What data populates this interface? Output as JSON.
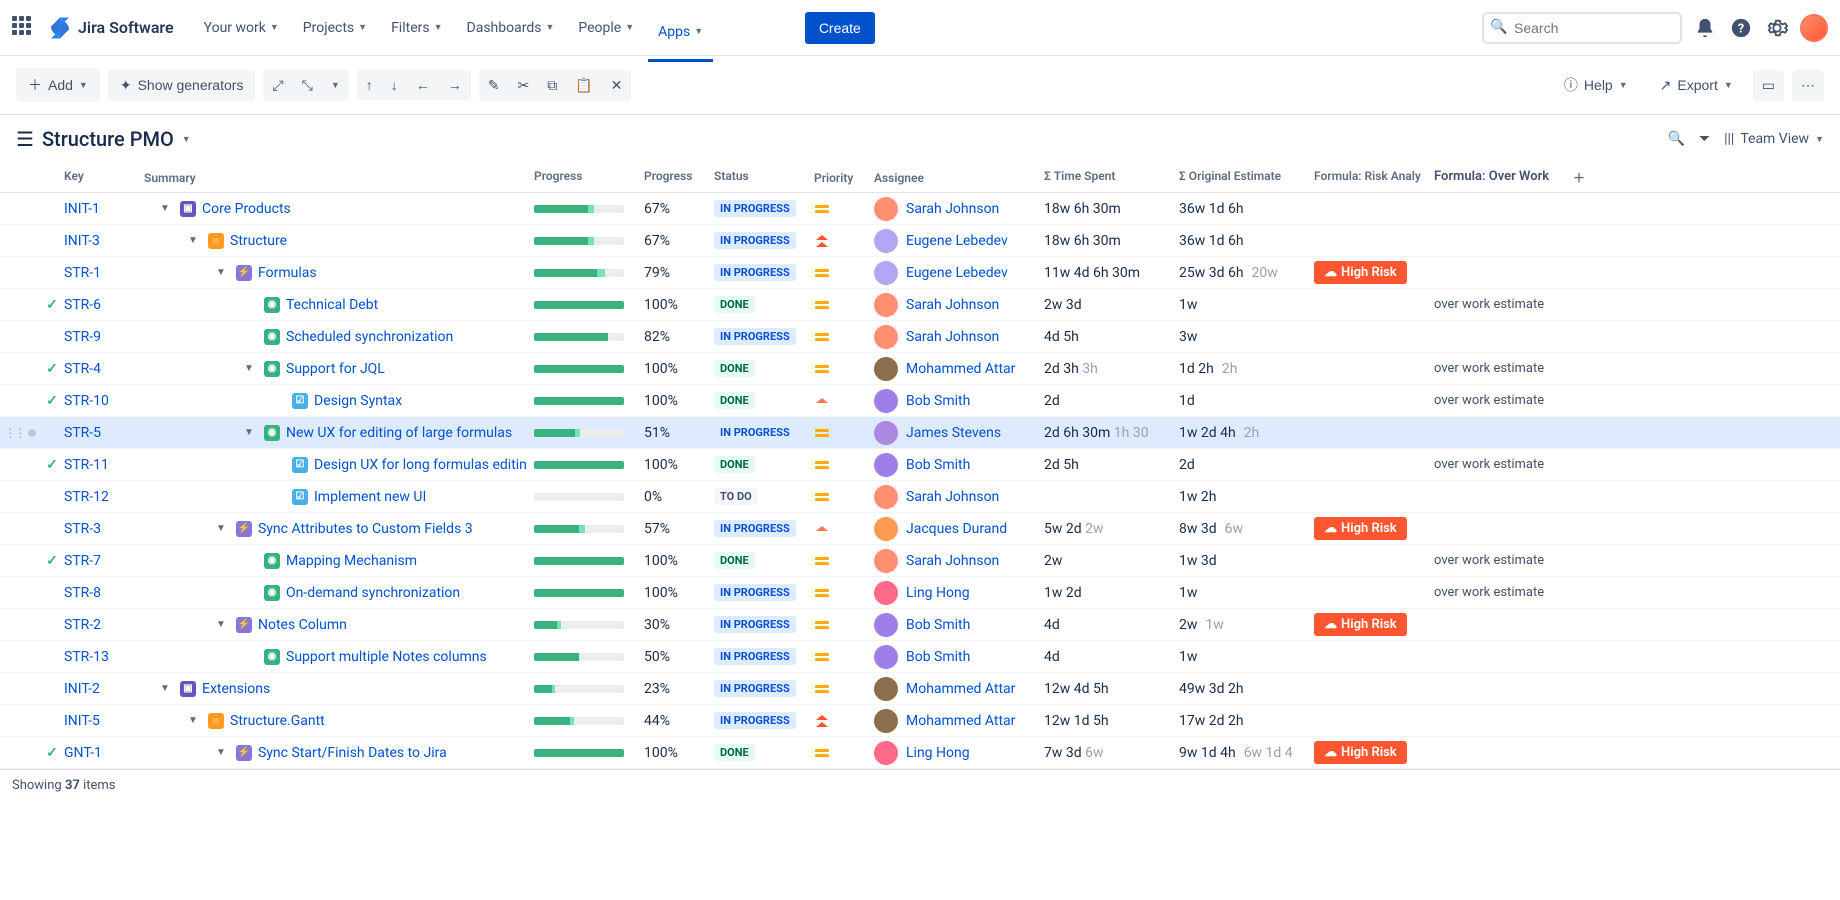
{
  "nav": {
    "logo": "Jira Software",
    "items": [
      "Your work",
      "Projects",
      "Filters",
      "Dashboards",
      "People",
      "Apps"
    ],
    "create": "Create",
    "search_placeholder": "Search"
  },
  "toolbar": {
    "add": "Add",
    "generators": "Show generators",
    "help": "Help",
    "export": "Export"
  },
  "structure": {
    "title": "Structure PMO",
    "view_label": "Team View"
  },
  "columns": {
    "key": "Key",
    "summary": "Summary",
    "progress": "Progress",
    "progress2": "Progress",
    "status": "Status",
    "priority": "Priority",
    "assignee": "Assignee",
    "time_spent": "Σ Time Spent",
    "estimate": "Σ Original Estimate",
    "risk": "Formula: Risk Analy",
    "overwork": "Formula: Over Work"
  },
  "footer": {
    "prefix": "Showing ",
    "count": "37",
    "suffix": " items"
  },
  "risk_label": "High Risk",
  "overwork_label": "over work estimate",
  "status_labels": {
    "inprogress": "IN PROGRESS",
    "done": "DONE",
    "todo": "TO DO"
  },
  "avatar_colors": {
    "Sarah Johnson": "#ff8f73",
    "Eugene Lebedev": "#b3a6f2",
    "Mohammed Attar": "#8d6e4b",
    "Bob Smith": "#9f7ee8",
    "James Stevens": "#ad88e0",
    "Jacques Durand": "#ff9a52",
    "Ling Hong": "#ff6b88"
  },
  "rows": [
    {
      "key": "INIT-1",
      "done": false,
      "indent": 0,
      "expand": true,
      "type": "initiative",
      "summary": "Core Products",
      "progress_done": 60,
      "progress_wip": 7,
      "progress_pct": "67%",
      "status": "inprogress",
      "priority": "medium",
      "assignee": "Sarah Johnson",
      "time": "18w 6h 30m",
      "estimate": "36w 1d 6h",
      "est2": "",
      "risk": false,
      "overwork": false
    },
    {
      "key": "INIT-3",
      "done": false,
      "indent": 1,
      "expand": true,
      "type": "idea",
      "summary": "Structure",
      "progress_done": 60,
      "progress_wip": 7,
      "progress_pct": "67%",
      "status": "inprogress",
      "priority": "highest",
      "assignee": "Eugene Lebedev",
      "time": "18w 6h 30m",
      "estimate": "36w 1d 6h",
      "est2": "",
      "risk": false,
      "overwork": false
    },
    {
      "key": "STR-1",
      "done": false,
      "indent": 2,
      "expand": true,
      "type": "epic",
      "summary": "Formulas",
      "progress_done": 70,
      "progress_wip": 9,
      "progress_pct": "79%",
      "status": "inprogress",
      "priority": "medium",
      "assignee": "Eugene Lebedev",
      "time": "11w 4d 6h 30m",
      "estimate": "25w 3d 6h",
      "est2": "20w",
      "risk": true,
      "overwork": false
    },
    {
      "key": "STR-6",
      "done": true,
      "indent": 3,
      "expand": false,
      "type": "story",
      "summary": "Technical Debt",
      "progress_done": 100,
      "progress_wip": 0,
      "progress_pct": "100%",
      "status": "done",
      "priority": "medium",
      "assignee": "Sarah Johnson",
      "time": "2w 3d",
      "estimate": "1w",
      "est2": "",
      "risk": false,
      "overwork": true
    },
    {
      "key": "STR-9",
      "done": false,
      "indent": 3,
      "expand": false,
      "type": "story",
      "summary": "Scheduled synchronization",
      "progress_done": 82,
      "progress_wip": 0,
      "progress_pct": "82%",
      "status": "inprogress",
      "priority": "medium",
      "assignee": "Sarah Johnson",
      "time": "4d 5h",
      "estimate": "3w",
      "est2": "",
      "risk": false,
      "overwork": false
    },
    {
      "key": "STR-4",
      "done": true,
      "indent": 3,
      "expand": true,
      "type": "story",
      "summary": "Support for JQL",
      "progress_done": 100,
      "progress_wip": 0,
      "progress_pct": "100%",
      "status": "done",
      "priority": "medium",
      "assignee": "Mohammed Attar",
      "time": "2d 3h",
      "time2": "3h",
      "estimate": "1d 2h",
      "est2": "2h",
      "risk": false,
      "overwork": true
    },
    {
      "key": "STR-10",
      "done": true,
      "indent": 4,
      "expand": false,
      "type": "task",
      "summary": "Design Syntax",
      "progress_done": 100,
      "progress_wip": 0,
      "progress_pct": "100%",
      "status": "done",
      "priority": "high",
      "assignee": "Bob Smith",
      "time": "2d",
      "estimate": "1d",
      "est2": "",
      "risk": false,
      "overwork": true
    },
    {
      "key": "STR-5",
      "done": false,
      "indent": 3,
      "expand": true,
      "type": "story",
      "summary": "New UX for editing of large formulas",
      "progress_done": 45,
      "progress_wip": 6,
      "progress_pct": "51%",
      "status": "inprogress",
      "priority": "medium",
      "assignee": "James Stevens",
      "time": "2d 6h 30m",
      "time2": "1h 30",
      "estimate": "1w 2d 4h",
      "est2": "2h",
      "risk": false,
      "overwork": false,
      "selected": true
    },
    {
      "key": "STR-11",
      "done": true,
      "indent": 4,
      "expand": false,
      "type": "task",
      "summary": "Design UX for long formulas editin",
      "progress_done": 100,
      "progress_wip": 0,
      "progress_pct": "100%",
      "status": "done",
      "priority": "medium",
      "assignee": "Bob Smith",
      "time": "2d 5h",
      "estimate": "2d",
      "est2": "",
      "risk": false,
      "overwork": true
    },
    {
      "key": "STR-12",
      "done": false,
      "indent": 4,
      "expand": false,
      "type": "task",
      "summary": "Implement new UI",
      "progress_done": 0,
      "progress_wip": 0,
      "progress_pct": "0%",
      "status": "todo",
      "priority": "medium",
      "assignee": "Sarah Johnson",
      "time": "",
      "estimate": "1w 2h",
      "est2": "",
      "risk": false,
      "overwork": false
    },
    {
      "key": "STR-3",
      "done": false,
      "indent": 2,
      "expand": true,
      "type": "epic",
      "summary": "Sync Attributes to Custom Fields 3",
      "progress_done": 50,
      "progress_wip": 7,
      "progress_pct": "57%",
      "status": "inprogress",
      "priority": "high",
      "assignee": "Jacques Durand",
      "time": "5w 2d",
      "time2": "2w",
      "estimate": "8w 3d",
      "est2": "6w",
      "risk": true,
      "overwork": false
    },
    {
      "key": "STR-7",
      "done": true,
      "indent": 3,
      "expand": false,
      "type": "story",
      "summary": "Mapping Mechanism",
      "progress_done": 100,
      "progress_wip": 0,
      "progress_pct": "100%",
      "status": "done",
      "priority": "medium",
      "assignee": "Sarah Johnson",
      "time": "2w",
      "estimate": "1w 3d",
      "est2": "",
      "risk": false,
      "overwork": true
    },
    {
      "key": "STR-8",
      "done": false,
      "indent": 3,
      "expand": false,
      "type": "story",
      "summary": "On-demand synchronization",
      "progress_done": 100,
      "progress_wip": 0,
      "progress_pct": "100%",
      "status": "inprogress",
      "priority": "medium",
      "assignee": "Ling Hong",
      "time": "1w 2d",
      "estimate": "1w",
      "est2": "",
      "risk": false,
      "overwork": true
    },
    {
      "key": "STR-2",
      "done": false,
      "indent": 2,
      "expand": true,
      "type": "epic",
      "summary": "Notes Column",
      "progress_done": 25,
      "progress_wip": 5,
      "progress_pct": "30%",
      "status": "inprogress",
      "priority": "medium",
      "assignee": "Bob Smith",
      "time": "4d",
      "estimate": "2w",
      "est2": "1w",
      "risk": true,
      "overwork": false
    },
    {
      "key": "STR-13",
      "done": false,
      "indent": 3,
      "expand": false,
      "type": "story",
      "summary": "Support multiple Notes columns",
      "progress_done": 50,
      "progress_wip": 0,
      "progress_pct": "50%",
      "status": "inprogress",
      "priority": "medium",
      "assignee": "Bob Smith",
      "time": "4d",
      "estimate": "1w",
      "est2": "",
      "risk": false,
      "overwork": false
    },
    {
      "key": "INIT-2",
      "done": false,
      "indent": 0,
      "expand": true,
      "type": "initiative",
      "summary": "Extensions",
      "progress_done": 20,
      "progress_wip": 3,
      "progress_pct": "23%",
      "status": "inprogress",
      "priority": "medium",
      "assignee": "Mohammed Attar",
      "time": "12w 4d 5h",
      "estimate": "49w 3d 2h",
      "est2": "",
      "risk": false,
      "overwork": false
    },
    {
      "key": "INIT-5",
      "done": false,
      "indent": 1,
      "expand": true,
      "type": "idea",
      "summary": "Structure.Gantt",
      "progress_done": 40,
      "progress_wip": 4,
      "progress_pct": "44%",
      "status": "inprogress",
      "priority": "highest",
      "assignee": "Mohammed Attar",
      "time": "12w 1d 5h",
      "estimate": "17w 2d 2h",
      "est2": "",
      "risk": false,
      "overwork": false
    },
    {
      "key": "GNT-1",
      "done": true,
      "indent": 2,
      "expand": true,
      "type": "epic",
      "summary": "Sync Start/Finish Dates to Jira",
      "progress_done": 100,
      "progress_wip": 0,
      "progress_pct": "100%",
      "status": "done",
      "priority": "medium",
      "assignee": "Ling Hong",
      "time": "7w 3d",
      "time2": "6w",
      "estimate": "9w 1d 4h",
      "est2": "6w 1d 4",
      "risk": true,
      "overwork": false
    }
  ]
}
